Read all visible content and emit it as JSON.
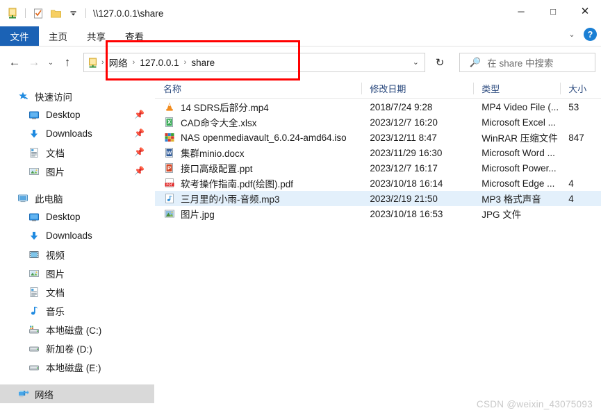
{
  "window": {
    "title": "\\\\127.0.0.1\\share",
    "quick_access_toolbar": [
      {
        "name": "share-folder-icon",
        "label": "\\\\127.0.0.1\\share"
      },
      {
        "name": "properties-icon",
        "label": "属性"
      },
      {
        "name": "new-folder-icon",
        "label": "新建文件夹"
      },
      {
        "name": "customize-chevron-icon",
        "label": "自定义快速访问工具栏"
      }
    ],
    "controls": {
      "minimize": "─",
      "maximize": "□",
      "close": "✕"
    }
  },
  "ribbon": {
    "tabs": [
      {
        "label": "文件",
        "active": true
      },
      {
        "label": "主页",
        "active": false
      },
      {
        "label": "共享",
        "active": false
      },
      {
        "label": "查看",
        "active": false
      }
    ],
    "collapse_label": "⌄",
    "help_label": "?",
    "accent_color": "#1b62b5"
  },
  "navbar": {
    "back_label": "←",
    "forward_label": "→",
    "recent_label": "⌄",
    "up_label": "↑",
    "refresh_label": "↻",
    "address_chevron": "⌄",
    "address_icon": "network-share-icon",
    "breadcrumbs": [
      {
        "label": "网络"
      },
      {
        "label": "127.0.0.1"
      },
      {
        "label": "share"
      }
    ],
    "separator": "›"
  },
  "search": {
    "placeholder": "在 share 中搜索",
    "icon": "search-icon"
  },
  "annotation": {
    "color": "#ff0000",
    "target": "address-bar-breadcrumb"
  },
  "sidebar": {
    "groups": [
      {
        "header": {
          "label": "快速访问",
          "icon": "star-pin-icon"
        },
        "items": [
          {
            "label": "Desktop",
            "icon": "desktop-icon",
            "pinned": true
          },
          {
            "label": "Downloads",
            "icon": "downloads-icon",
            "pinned": true
          },
          {
            "label": "文档",
            "icon": "documents-icon",
            "pinned": true
          },
          {
            "label": "图片",
            "icon": "pictures-icon",
            "pinned": true
          }
        ]
      },
      {
        "header": {
          "label": "此电脑",
          "icon": "this-pc-icon"
        },
        "items": [
          {
            "label": "Desktop",
            "icon": "desktop-icon",
            "pinned": false
          },
          {
            "label": "Downloads",
            "icon": "downloads-icon",
            "pinned": false
          },
          {
            "label": "视频",
            "icon": "videos-icon",
            "pinned": false
          },
          {
            "label": "图片",
            "icon": "pictures-icon",
            "pinned": false
          },
          {
            "label": "文档",
            "icon": "documents-icon",
            "pinned": false
          },
          {
            "label": "音乐",
            "icon": "music-icon",
            "pinned": false
          },
          {
            "label": "本地磁盘 (C:)",
            "icon": "system-drive-icon",
            "pinned": false
          },
          {
            "label": "新加卷 (D:)",
            "icon": "drive-icon",
            "pinned": false
          },
          {
            "label": "本地磁盘 (E:)",
            "icon": "drive-icon",
            "pinned": false
          }
        ]
      }
    ],
    "network": {
      "label": "网络",
      "icon": "network-icon",
      "selected": true
    }
  },
  "filelist": {
    "columns": [
      {
        "key": "name",
        "label": "名称"
      },
      {
        "key": "date",
        "label": "修改日期"
      },
      {
        "key": "type",
        "label": "类型"
      },
      {
        "key": "size",
        "label": "大小"
      }
    ],
    "rows": [
      {
        "name": "14 SDRS后部分.mp4",
        "date": "2018/7/24 9:28",
        "type": "MP4 Video File (...",
        "size": "53",
        "icon": "vlc-media-icon",
        "selected": false
      },
      {
        "name": "CAD命令大全.xlsx",
        "date": "2023/12/7 16:20",
        "type": "Microsoft Excel ...",
        "size": "",
        "icon": "excel-icon",
        "selected": false
      },
      {
        "name": "NAS openmediavault_6.0.24-amd64.iso",
        "date": "2023/12/11 8:47",
        "type": "WinRAR 压缩文件",
        "size": "847",
        "icon": "winrar-icon",
        "selected": false
      },
      {
        "name": "集群minio.docx",
        "date": "2023/11/29 16:30",
        "type": "Microsoft Word ...",
        "size": "",
        "icon": "word-icon",
        "selected": false
      },
      {
        "name": "接口高级配置.ppt",
        "date": "2023/12/7 16:17",
        "type": "Microsoft Power...",
        "size": "",
        "icon": "powerpoint-icon",
        "selected": false
      },
      {
        "name": "软考操作指南.pdf(绘图).pdf",
        "date": "2023/10/18 16:14",
        "type": "Microsoft Edge ...",
        "size": "4",
        "icon": "pdf-icon",
        "selected": false
      },
      {
        "name": "三月里的小雨-音频.mp3",
        "date": "2023/2/19 21:50",
        "type": "MP3 格式声音",
        "size": "4",
        "icon": "music-file-icon",
        "selected": true
      },
      {
        "name": "图片.jpg",
        "date": "2023/10/18 16:53",
        "type": "JPG 文件",
        "size": "",
        "icon": "image-file-icon",
        "selected": false
      }
    ]
  },
  "watermark": {
    "text": "CSDN @weixin_43075093"
  }
}
